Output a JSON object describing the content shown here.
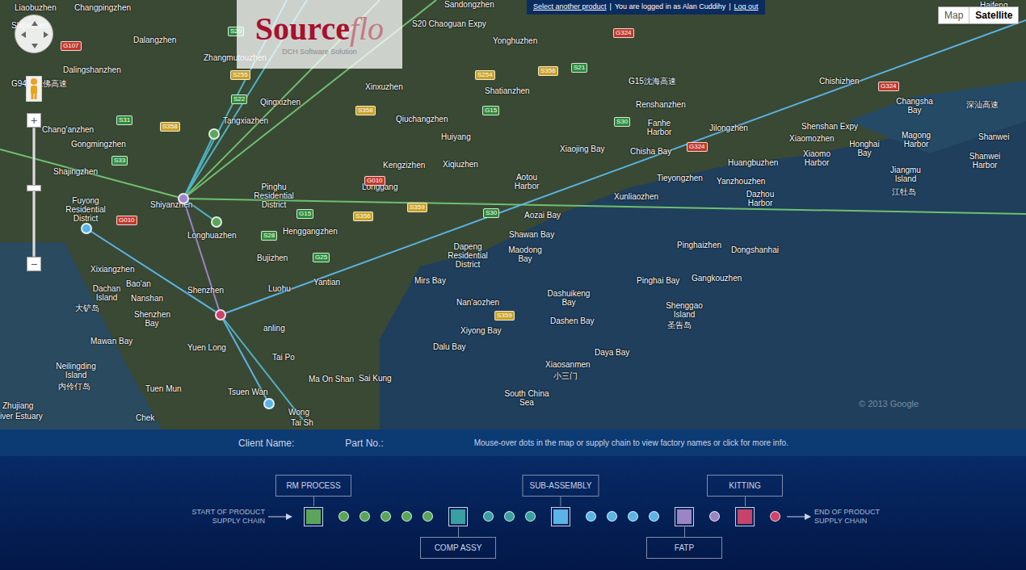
{
  "header": {
    "select_product": "Select another product",
    "separator": "|",
    "logged_in": "You are logged in as Alan Cuddihy",
    "logout": "Log out"
  },
  "logo": {
    "main": "Source",
    "accent": "flo",
    "sub": "DCH Software Solution"
  },
  "map_types": [
    {
      "label": "Map",
      "selected": false
    },
    {
      "label": "Satellite",
      "selected": true
    }
  ],
  "zoom": {
    "zoom_in": "+",
    "zoom_out": "−",
    "level": 0.53
  },
  "map": {
    "labels": [
      "Liaobuzhen",
      "Changpingzhen",
      "Shijiezhen",
      "Dalangzhen",
      "Dalingshanzhen",
      "Zhangmutouzhen",
      "Qingxizhen",
      "Tangxiazhen",
      "Chang'anzhen",
      "Gongmingzhen",
      "Shajingzhen",
      "Fuyong Residential District",
      "Shiyanzhen",
      "Longhuazhen",
      "Pinghu Residential District",
      "Henggangzhen",
      "Bujizhen",
      "Luohu",
      "Shenzhen",
      "Xixiangzhen",
      "Bao'an",
      "Nanshan",
      "Shenzhen Bay",
      "Dachan Island",
      "大铲岛",
      "Mawan Bay",
      "Yuen Long",
      "Tai Po",
      "Ma On Shan",
      "Sai Kung",
      "Tsuen Wan",
      "Tuen Mun",
      "Neilingding Island",
      "内伶仃岛",
      "Zhujiang",
      "iver Estuary",
      "Chek",
      "Wong",
      "Tai Sh",
      "anling",
      "Yantian",
      "Longgang",
      "Kengzizhen",
      "Xiqiuzhen",
      "Huiyang",
      "Qiuchangzhen",
      "Xinxuzhen",
      "Shatianzhen",
      "Yonghuzhen",
      "Sandongzhen",
      "Aotou Harbor",
      "Xiaojing Bay",
      "Aozai Bay",
      "Shawan Bay",
      "Maodong Bay",
      "Dapeng Residential District",
      "Mirs Bay",
      "Nan'aozhen",
      "Dashuikeng Bay",
      "Dashen Bay",
      "Xiyong Bay",
      "Dalu Bay",
      "Daya Bay",
      "Xiaosanmen",
      "小三门",
      "South China Sea",
      "Shenggao Island",
      "圣告岛",
      "Pinghai Bay",
      "Gangkouzhen",
      "Dongshanhai",
      "Pinghaizhen",
      "Xunliaozhen",
      "Dazhou Harbor",
      "Yanzhouzhen",
      "Huangbuzhen",
      "Tieyongzhen",
      "Chisha Bay",
      "Fanhe Harbor",
      "Renshanzhen",
      "Jilongzhen",
      "Chishizhen",
      "Xiaomozhen",
      "Xiaomo Harbor",
      "Honghai Bay",
      "Changsha Bay",
      "Magong Harbor",
      "Jiangmu Island",
      "江牡岛",
      "Shanwei",
      "Shanwei Harbor",
      "Haifeng",
      "Shenshan Expy",
      "S20 Chaoguan Expy",
      "G15沈海高速",
      "深汕高速",
      "G9411莞佛高速"
    ],
    "roads": [
      {
        "label": "G107",
        "color": "#c0392b"
      },
      {
        "label": "S20",
        "color": "#2e8b3a"
      },
      {
        "label": "S255",
        "color": "#c9a227"
      },
      {
        "label": "S22",
        "color": "#2e8b3a"
      },
      {
        "label": "S358",
        "color": "#c9a227"
      },
      {
        "label": "S31",
        "color": "#2e8b3a"
      },
      {
        "label": "S33",
        "color": "#2e8b3a"
      },
      {
        "label": "G010",
        "color": "#c0392b"
      },
      {
        "label": "S358",
        "color": "#c9a227"
      },
      {
        "label": "G15",
        "color": "#2e8b3a"
      },
      {
        "label": "S30",
        "color": "#2e8b3a"
      },
      {
        "label": "S21",
        "color": "#2e8b3a"
      },
      {
        "label": "S356",
        "color": "#c9a227"
      },
      {
        "label": "S254",
        "color": "#c9a227"
      },
      {
        "label": "G324",
        "color": "#c0392b"
      },
      {
        "label": "G324",
        "color": "#c0392b"
      },
      {
        "label": "G324",
        "color": "#c0392b"
      },
      {
        "label": "S356",
        "color": "#c9a227"
      },
      {
        "label": "G15",
        "color": "#2e8b3a"
      },
      {
        "label": "S28",
        "color": "#2e8b3a"
      },
      {
        "label": "G25",
        "color": "#2e8b3a"
      },
      {
        "label": "S359",
        "color": "#c9a227"
      },
      {
        "label": "G010",
        "color": "#c0392b"
      },
      {
        "label": "S359",
        "color": "#c9a227"
      },
      {
        "label": "S30",
        "color": "#2e8b3a"
      }
    ],
    "nodes": [
      {
        "color": "#9b85c4"
      },
      {
        "color": "#5aa55a"
      },
      {
        "color": "#5aa55a"
      },
      {
        "color": "#5ab4e6"
      },
      {
        "color": "#c8436a"
      },
      {
        "color": "#5ab4e6"
      }
    ],
    "copyright": "© 2013 Google"
  },
  "info_bar": {
    "client_label": "Client Name:",
    "part_label": "Part No.:",
    "hint": "Mouse-over dots in the map or supply chain to view factory names or click for more info."
  },
  "chain": {
    "start_lines": [
      "START OF PRODUCT",
      "SUPPLY CHAIN"
    ],
    "end_lines": [
      "END OF PRODUCT",
      "SUPPLY CHAIN"
    ],
    "items": [
      {
        "kind": "stage",
        "label": "RM PROCESS",
        "color": "#5aa55a"
      },
      {
        "kind": "dot",
        "color": "#5aa55a"
      },
      {
        "kind": "dot",
        "color": "#5aa55a"
      },
      {
        "kind": "dot",
        "color": "#5aa55a"
      },
      {
        "kind": "dot",
        "color": "#5aa55a"
      },
      {
        "kind": "dot",
        "color": "#5aa55a"
      },
      {
        "kind": "stage",
        "label": "COMP ASSY",
        "color": "#3a9fa0"
      },
      {
        "kind": "dot",
        "color": "#3a9fa0"
      },
      {
        "kind": "dot",
        "color": "#3a9fa0"
      },
      {
        "kind": "dot",
        "color": "#3a9fa0"
      },
      {
        "kind": "stage",
        "label": "SUB-ASSEMBLY",
        "color": "#5ab4e6"
      },
      {
        "kind": "dot",
        "color": "#5ab4e6"
      },
      {
        "kind": "dot",
        "color": "#5ab4e6"
      },
      {
        "kind": "dot",
        "color": "#5ab4e6"
      },
      {
        "kind": "dot",
        "color": "#5ab4e6"
      },
      {
        "kind": "stage",
        "label": "FATP",
        "color": "#9b85c4"
      },
      {
        "kind": "dot",
        "color": "#9b85c4"
      },
      {
        "kind": "stage",
        "label": "KITTING",
        "color": "#c8436a"
      },
      {
        "kind": "dot",
        "color": "#d0436a"
      }
    ]
  }
}
